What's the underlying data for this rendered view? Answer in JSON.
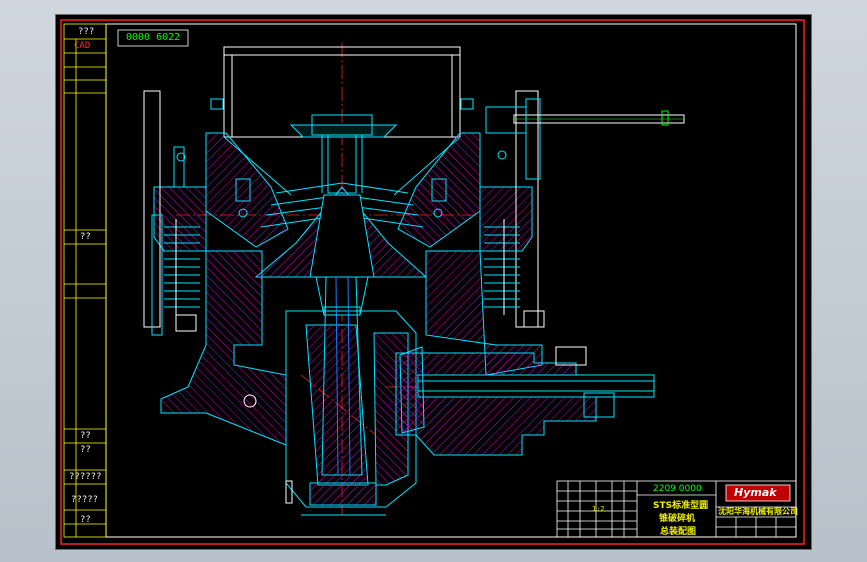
{
  "drawing_number": "0000 6022",
  "left_strip": {
    "label_top": "???",
    "label_cad": "CAD",
    "label_mid": "??",
    "label_a": "??",
    "label_b": "??",
    "label_c": "??????",
    "label_d": "?????",
    "label_e": "??"
  },
  "title_block": {
    "part_code": "2209 0000",
    "title_line1": "STS标准型圆",
    "title_line2": "锥破碎机",
    "title_line3": "总装配图",
    "company": "沈阳华海机械有限公司",
    "logo_text": "Hymak",
    "scale": "1:2"
  },
  "colors": {
    "frame": "#ff1a1a",
    "outline": "#00e5ff",
    "hatch": "#e000e0",
    "centerline": "#ff2020",
    "title": "#f0f000",
    "leader": "#00ff00",
    "edge": "#ffffff"
  }
}
